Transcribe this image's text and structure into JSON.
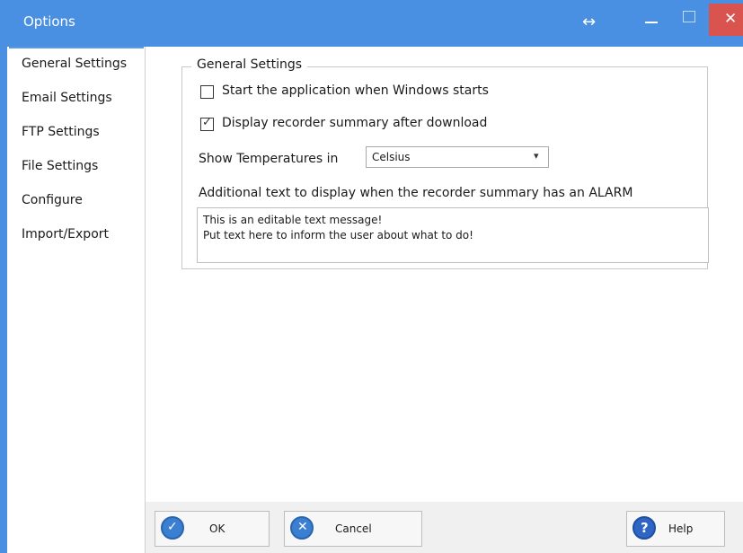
{
  "window": {
    "title": "Options",
    "resize_glyph": "↔",
    "close_glyph": "✕"
  },
  "nav": {
    "items": [
      {
        "label": "General Settings"
      },
      {
        "label": "Email Settings"
      },
      {
        "label": "FTP Settings"
      },
      {
        "label": "File Settings"
      },
      {
        "label": "Configure"
      },
      {
        "label": "Import/Export"
      }
    ],
    "active": "General Settings"
  },
  "general": {
    "group_title": "General Settings",
    "start_with_windows": {
      "label": "Start the application when Windows starts",
      "checked": false
    },
    "display_summary": {
      "label": "Display recorder summary after download",
      "checked": true,
      "mark": "✓"
    },
    "temperature": {
      "label": "Show Temperatures in",
      "value": "Celsius",
      "chevron": "▾"
    },
    "alarm_text": {
      "label": "Additional text to display when the recorder summary has an ALARM",
      "lines": [
        "This is an editable text message!",
        "Put text here to inform the user about what to do!"
      ]
    }
  },
  "buttons": {
    "ok": {
      "label": "OK",
      "icon": "check-icon",
      "glyph": "✓"
    },
    "cancel": {
      "label": "Cancel",
      "icon": "x-icon",
      "glyph": "✕"
    },
    "help": {
      "label": "Help",
      "icon": "question-icon",
      "glyph": "?"
    }
  },
  "colors": {
    "titlebar": "#4a90e2",
    "close": "#d9534f",
    "accent": "#3b7fd1"
  }
}
